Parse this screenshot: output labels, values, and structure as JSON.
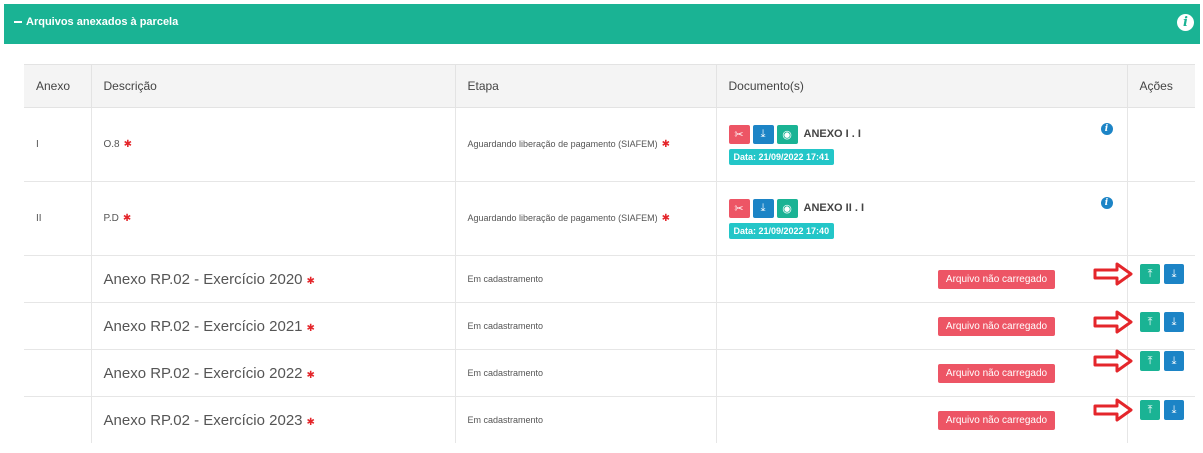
{
  "panel": {
    "title": "Arquivos anexados à parcela",
    "toggle_icon": "minus-icon",
    "info_icon": "info-icon"
  },
  "table": {
    "headers": [
      "Anexo",
      "Descrição",
      "Etapa",
      "Documento(s)",
      "Ações"
    ],
    "rows": [
      {
        "anexo": "I",
        "descricao": "O.8",
        "required": "✱",
        "etapa": "Aguardando liberação de pagamento (SIAFEM)",
        "doc_name": "ANEXO I . I",
        "doc_date": "Data: 21/09/2022 17:41"
      },
      {
        "anexo": "II",
        "descricao": "P.D",
        "required": "✱",
        "etapa": "Aguardando liberação de pagamento (SIAFEM)",
        "doc_name": "ANEXO II . I",
        "doc_date": "Data: 21/09/2022 17:40"
      },
      {
        "anexo": "",
        "descricao": "Anexo RP.02 - Exercício 2020",
        "required": "✱",
        "etapa": "Em cadastramento",
        "status": "Arquivo não carregado"
      },
      {
        "anexo": "",
        "descricao": "Anexo RP.02 - Exercício 2021",
        "required": "✱",
        "etapa": "Em cadastramento",
        "status": "Arquivo não carregado"
      },
      {
        "anexo": "",
        "descricao": "Anexo RP.02 - Exercício 2022",
        "required": "✱",
        "etapa": "Em cadastramento",
        "status": "Arquivo não carregado"
      },
      {
        "anexo": "",
        "descricao": "Anexo RP.02 - Exercício 2023",
        "required": "✱",
        "etapa": "Em cadastramento",
        "status": "Arquivo não carregado"
      }
    ]
  },
  "icons": {
    "delete": "scissors-icon",
    "upload": "upload-icon",
    "download": "download-icon",
    "view": "eye-icon",
    "annotation": "red-arrow-icon"
  },
  "colors": {
    "header_green": "#1ab394",
    "danger": "#ed5565",
    "primary": "#1c84c6",
    "info": "#23c6c8",
    "required": "#e4262b"
  }
}
